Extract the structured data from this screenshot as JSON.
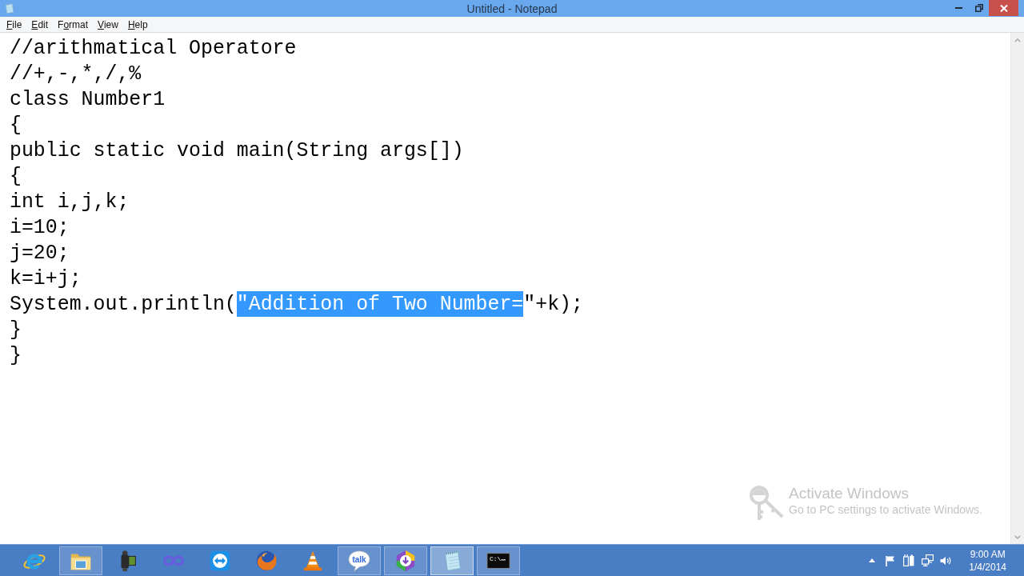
{
  "window": {
    "title": "Untitled - Notepad"
  },
  "menu": [
    {
      "key": "F",
      "rest": "ile"
    },
    {
      "key": "E",
      "rest": "dit"
    },
    {
      "lead": "F",
      "key": "o",
      "rest": "rmat"
    },
    {
      "key": "V",
      "rest": "iew"
    },
    {
      "key": "H",
      "rest": "elp"
    }
  ],
  "editor": {
    "lines": [
      {
        "segments": [
          {
            "text": "//arithmatical Operatore",
            "selected": false
          }
        ]
      },
      {
        "segments": [
          {
            "text": "//+,-,*,/,%",
            "selected": false
          }
        ]
      },
      {
        "segments": [
          {
            "text": "class Number1",
            "selected": false
          }
        ]
      },
      {
        "segments": [
          {
            "text": "{",
            "selected": false
          }
        ]
      },
      {
        "segments": [
          {
            "text": "public static void main(String args[])",
            "selected": false
          }
        ]
      },
      {
        "segments": [
          {
            "text": "{",
            "selected": false
          }
        ]
      },
      {
        "segments": [
          {
            "text": "int i,j,k;",
            "selected": false
          }
        ]
      },
      {
        "segments": [
          {
            "text": "i=10;",
            "selected": false
          }
        ]
      },
      {
        "segments": [
          {
            "text": "j=20;",
            "selected": false
          }
        ]
      },
      {
        "segments": [
          {
            "text": "k=i+j;",
            "selected": false
          }
        ]
      },
      {
        "segments": [
          {
            "text": "System.out.println(",
            "selected": false
          },
          {
            "text": "\"Addition of Two Number=",
            "selected": true
          },
          {
            "text": "\"+k);",
            "selected": false
          }
        ]
      },
      {
        "segments": [
          {
            "text": "}",
            "selected": false
          }
        ]
      },
      {
        "segments": [
          {
            "text": "}",
            "selected": false
          }
        ]
      }
    ]
  },
  "activation_notice": {
    "title": "Activate Windows",
    "message": "Go to PC settings to activate Windows."
  },
  "taskbar": {
    "apps": [
      {
        "kind": "e_globe",
        "running": false,
        "selected": false
      },
      {
        "kind": "folder",
        "running": true,
        "selected": false
      },
      {
        "kind": "camcorder",
        "running": false,
        "selected": false
      },
      {
        "kind": "infinity",
        "running": false,
        "selected": false
      },
      {
        "kind": "arrows",
        "running": false,
        "selected": false
      },
      {
        "kind": "fox",
        "running": false,
        "selected": false
      },
      {
        "kind": "cone",
        "running": false,
        "selected": false
      },
      {
        "kind": "chat",
        "label": "talk",
        "running": true,
        "selected": false
      },
      {
        "kind": "download",
        "running": true,
        "selected": false
      },
      {
        "kind": "notepad",
        "running": true,
        "selected": true
      },
      {
        "kind": "terminal",
        "label": "C:\\",
        "running": true,
        "selected": false
      }
    ],
    "clock": {
      "time": "9:00 AM",
      "date": "1/4/2014"
    }
  }
}
